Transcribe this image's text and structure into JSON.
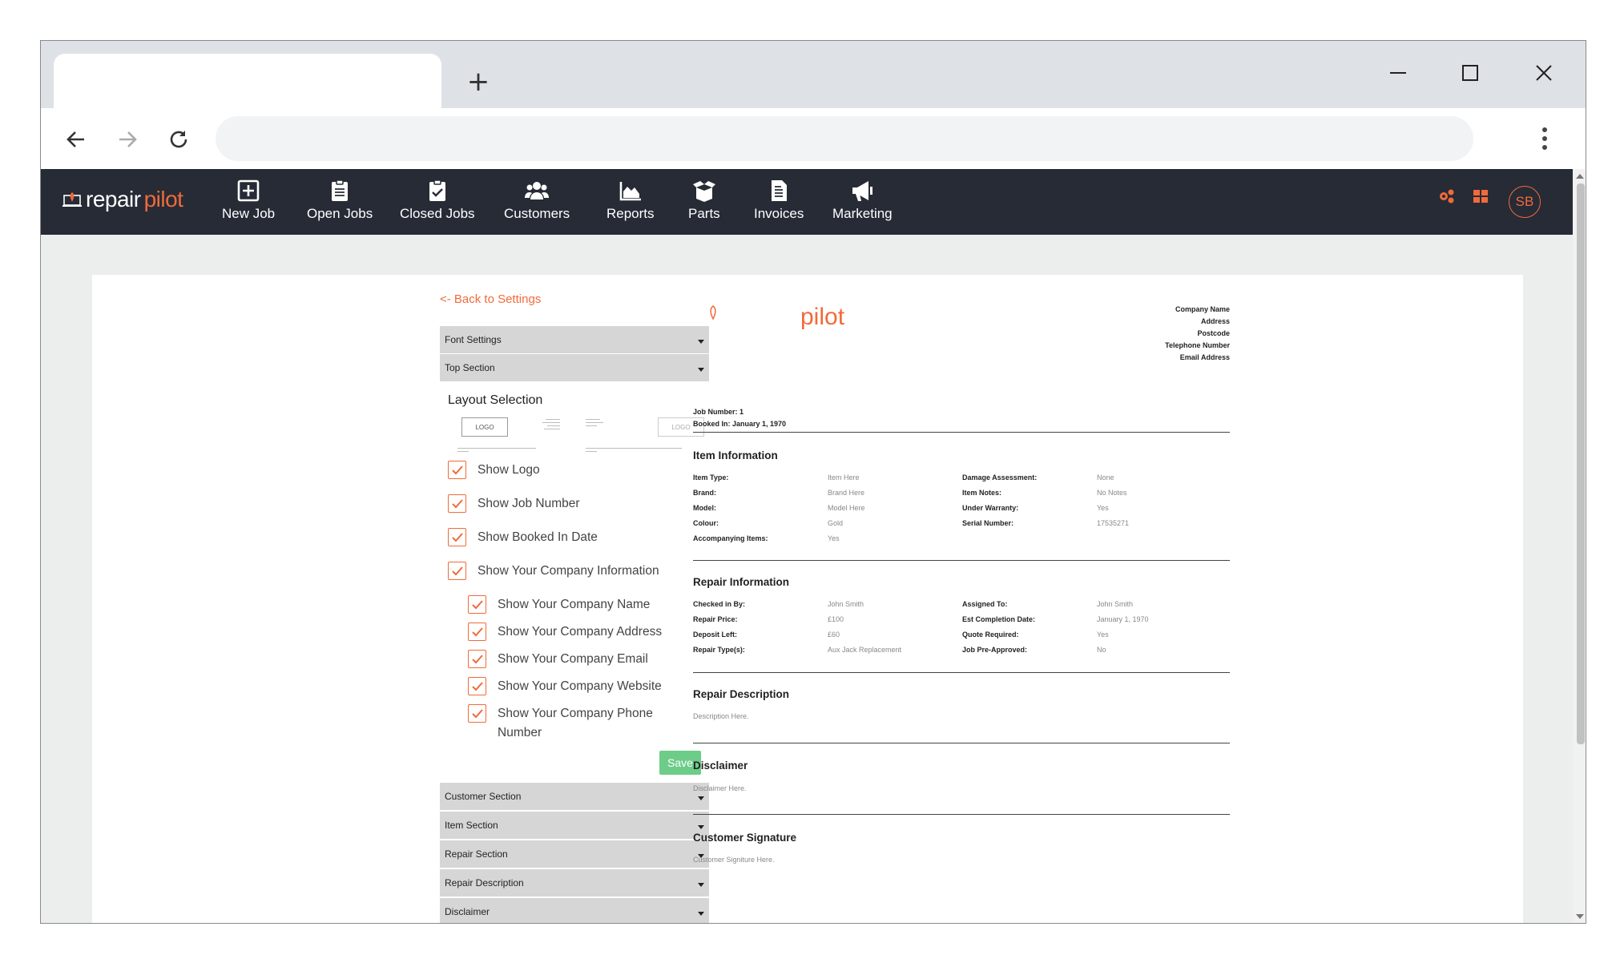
{
  "browser": {
    "new_tab_symbol": "+",
    "buttons": [
      "minimize-icon",
      "maximize-icon",
      "close-icon"
    ]
  },
  "nav": {
    "brand_repair": "repair",
    "brand_pilot": "pilot",
    "items": [
      {
        "label": "New Job",
        "icon": "plus-square-icon"
      },
      {
        "label": "Open Jobs",
        "icon": "clipboard-list-icon"
      },
      {
        "label": "Closed Jobs",
        "icon": "clipboard-check-icon"
      },
      {
        "label": "Customers",
        "icon": "users-icon"
      },
      {
        "label": "Reports",
        "icon": "chart-area-icon"
      },
      {
        "label": "Parts",
        "icon": "box-open-icon"
      },
      {
        "label": "Invoices",
        "icon": "invoice-icon"
      },
      {
        "label": "Marketing",
        "icon": "megaphone-icon"
      }
    ],
    "avatar": "SB",
    "accent": "#f26a3a"
  },
  "settings": {
    "back_link": "<- Back to Settings",
    "accordions_top": [
      "Font Settings",
      "Top Section"
    ],
    "layout_selection_title": "Layout Selection",
    "layout_logo_text": "LOGO",
    "checkboxes": [
      {
        "label": "Show Logo",
        "checked": true
      },
      {
        "label": "Show Job Number",
        "checked": true
      },
      {
        "label": "Show Booked In Date",
        "checked": true
      },
      {
        "label": "Show Your Company Information",
        "checked": true
      }
    ],
    "sub_checkboxes": [
      {
        "label": "Show Your Company Name",
        "checked": true
      },
      {
        "label": "Show Your Company Address",
        "checked": true
      },
      {
        "label": "Show Your Company Email",
        "checked": true
      },
      {
        "label": "Show Your Company Website",
        "checked": true
      },
      {
        "label": "Show Your Company Phone Number",
        "checked": true
      }
    ],
    "save_label": "Save",
    "accordions_bottom": [
      "Customer Section",
      "Item Section",
      "Repair Section",
      "Repair Description",
      "Disclaimer"
    ]
  },
  "preview": {
    "logo_text": "pilot",
    "company": [
      "Company Name",
      "Address",
      "Postcode",
      "Telephone Number",
      "Email Address"
    ],
    "job_number": "Job Number: 1",
    "booked_in": "Booked In: January 1, 1970",
    "item_info": {
      "title": "Item Information",
      "rows": [
        [
          "Item Type:",
          "Item Here",
          "Damage Assessment:",
          "None"
        ],
        [
          "Brand:",
          "Brand Here",
          "Item Notes:",
          "No Notes"
        ],
        [
          "Model:",
          "Model Here",
          "Under Warranty:",
          "Yes"
        ],
        [
          "Colour:",
          "Gold",
          "Serial Number:",
          "17535271"
        ],
        [
          "Accompanying Items:",
          "Yes",
          "",
          ""
        ]
      ]
    },
    "repair_info": {
      "title": "Repair Information",
      "rows": [
        [
          "Checked in By:",
          "John Smith",
          "Assigned To:",
          "John Smith"
        ],
        [
          "Repair Price:",
          "£100",
          "Est Completion Date:",
          "January 1, 1970"
        ],
        [
          "Deposit Left:",
          "£60",
          "Quote Required:",
          "Yes"
        ],
        [
          "Repair Type(s):",
          "Aux Jack Replacement",
          "Job Pre-Approved:",
          "No"
        ]
      ]
    },
    "repair_description": {
      "title": "Repair Description",
      "text": "Description Here."
    },
    "disclaimer": {
      "title": "Disclaimer",
      "text": "Disclaimer Here."
    },
    "signature": {
      "title": "Customer Signature",
      "text": "Customer Signiture Here."
    }
  }
}
